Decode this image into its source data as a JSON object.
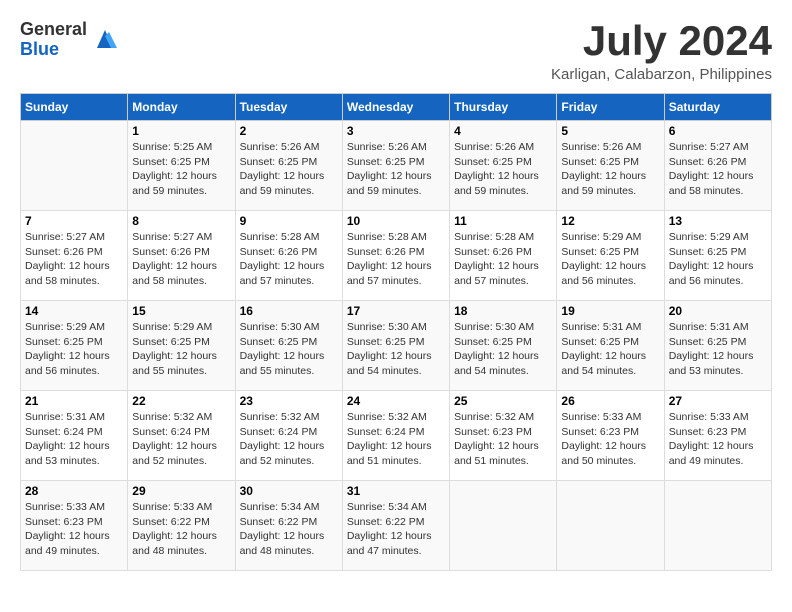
{
  "header": {
    "logo_general": "General",
    "logo_blue": "Blue",
    "month_title": "July 2024",
    "location": "Karligan, Calabarzon, Philippines"
  },
  "weekdays": [
    "Sunday",
    "Monday",
    "Tuesday",
    "Wednesday",
    "Thursday",
    "Friday",
    "Saturday"
  ],
  "weeks": [
    [
      {
        "day": "",
        "info": ""
      },
      {
        "day": "1",
        "info": "Sunrise: 5:25 AM\nSunset: 6:25 PM\nDaylight: 12 hours\nand 59 minutes."
      },
      {
        "day": "2",
        "info": "Sunrise: 5:26 AM\nSunset: 6:25 PM\nDaylight: 12 hours\nand 59 minutes."
      },
      {
        "day": "3",
        "info": "Sunrise: 5:26 AM\nSunset: 6:25 PM\nDaylight: 12 hours\nand 59 minutes."
      },
      {
        "day": "4",
        "info": "Sunrise: 5:26 AM\nSunset: 6:25 PM\nDaylight: 12 hours\nand 59 minutes."
      },
      {
        "day": "5",
        "info": "Sunrise: 5:26 AM\nSunset: 6:25 PM\nDaylight: 12 hours\nand 59 minutes."
      },
      {
        "day": "6",
        "info": "Sunrise: 5:27 AM\nSunset: 6:26 PM\nDaylight: 12 hours\nand 58 minutes."
      }
    ],
    [
      {
        "day": "7",
        "info": "Sunrise: 5:27 AM\nSunset: 6:26 PM\nDaylight: 12 hours\nand 58 minutes."
      },
      {
        "day": "8",
        "info": "Sunrise: 5:27 AM\nSunset: 6:26 PM\nDaylight: 12 hours\nand 58 minutes."
      },
      {
        "day": "9",
        "info": "Sunrise: 5:28 AM\nSunset: 6:26 PM\nDaylight: 12 hours\nand 57 minutes."
      },
      {
        "day": "10",
        "info": "Sunrise: 5:28 AM\nSunset: 6:26 PM\nDaylight: 12 hours\nand 57 minutes."
      },
      {
        "day": "11",
        "info": "Sunrise: 5:28 AM\nSunset: 6:26 PM\nDaylight: 12 hours\nand 57 minutes."
      },
      {
        "day": "12",
        "info": "Sunrise: 5:29 AM\nSunset: 6:25 PM\nDaylight: 12 hours\nand 56 minutes."
      },
      {
        "day": "13",
        "info": "Sunrise: 5:29 AM\nSunset: 6:25 PM\nDaylight: 12 hours\nand 56 minutes."
      }
    ],
    [
      {
        "day": "14",
        "info": "Sunrise: 5:29 AM\nSunset: 6:25 PM\nDaylight: 12 hours\nand 56 minutes."
      },
      {
        "day": "15",
        "info": "Sunrise: 5:29 AM\nSunset: 6:25 PM\nDaylight: 12 hours\nand 55 minutes."
      },
      {
        "day": "16",
        "info": "Sunrise: 5:30 AM\nSunset: 6:25 PM\nDaylight: 12 hours\nand 55 minutes."
      },
      {
        "day": "17",
        "info": "Sunrise: 5:30 AM\nSunset: 6:25 PM\nDaylight: 12 hours\nand 54 minutes."
      },
      {
        "day": "18",
        "info": "Sunrise: 5:30 AM\nSunset: 6:25 PM\nDaylight: 12 hours\nand 54 minutes."
      },
      {
        "day": "19",
        "info": "Sunrise: 5:31 AM\nSunset: 6:25 PM\nDaylight: 12 hours\nand 54 minutes."
      },
      {
        "day": "20",
        "info": "Sunrise: 5:31 AM\nSunset: 6:25 PM\nDaylight: 12 hours\nand 53 minutes."
      }
    ],
    [
      {
        "day": "21",
        "info": "Sunrise: 5:31 AM\nSunset: 6:24 PM\nDaylight: 12 hours\nand 53 minutes."
      },
      {
        "day": "22",
        "info": "Sunrise: 5:32 AM\nSunset: 6:24 PM\nDaylight: 12 hours\nand 52 minutes."
      },
      {
        "day": "23",
        "info": "Sunrise: 5:32 AM\nSunset: 6:24 PM\nDaylight: 12 hours\nand 52 minutes."
      },
      {
        "day": "24",
        "info": "Sunrise: 5:32 AM\nSunset: 6:24 PM\nDaylight: 12 hours\nand 51 minutes."
      },
      {
        "day": "25",
        "info": "Sunrise: 5:32 AM\nSunset: 6:23 PM\nDaylight: 12 hours\nand 51 minutes."
      },
      {
        "day": "26",
        "info": "Sunrise: 5:33 AM\nSunset: 6:23 PM\nDaylight: 12 hours\nand 50 minutes."
      },
      {
        "day": "27",
        "info": "Sunrise: 5:33 AM\nSunset: 6:23 PM\nDaylight: 12 hours\nand 49 minutes."
      }
    ],
    [
      {
        "day": "28",
        "info": "Sunrise: 5:33 AM\nSunset: 6:23 PM\nDaylight: 12 hours\nand 49 minutes."
      },
      {
        "day": "29",
        "info": "Sunrise: 5:33 AM\nSunset: 6:22 PM\nDaylight: 12 hours\nand 48 minutes."
      },
      {
        "day": "30",
        "info": "Sunrise: 5:34 AM\nSunset: 6:22 PM\nDaylight: 12 hours\nand 48 minutes."
      },
      {
        "day": "31",
        "info": "Sunrise: 5:34 AM\nSunset: 6:22 PM\nDaylight: 12 hours\nand 47 minutes."
      },
      {
        "day": "",
        "info": ""
      },
      {
        "day": "",
        "info": ""
      },
      {
        "day": "",
        "info": ""
      }
    ]
  ]
}
